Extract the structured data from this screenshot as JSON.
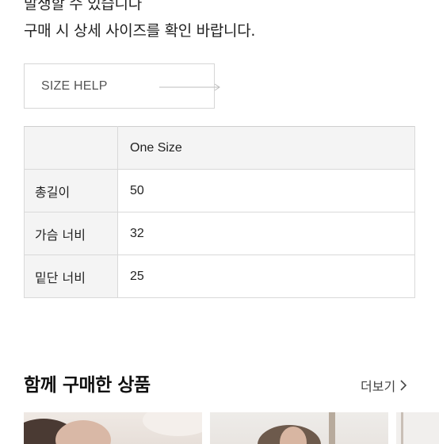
{
  "notice": {
    "line1": "발생할 수 있습니다",
    "line2": "구매 시 상세 사이즈를 확인 바랍니다."
  },
  "size_help": {
    "label": "SIZE HELP",
    "icon": "arrow-right-icon"
  },
  "size_table": {
    "header": [
      "",
      "One Size"
    ],
    "rows": [
      {
        "label": "총길이",
        "value": "50"
      },
      {
        "label": "가슴 너비",
        "value": "32"
      },
      {
        "label": "밑단 너비",
        "value": "25"
      }
    ]
  },
  "related": {
    "title": "함께 구매한 상품",
    "more_label": "더보기",
    "more_icon": "chevron-right-icon",
    "thumbnails": [
      "product-thumbnail-1",
      "product-thumbnail-2",
      "product-thumbnail-3"
    ]
  },
  "colors": {
    "border": "#d9d9d9",
    "header_bg": "#f4f4f4",
    "text": "#222222"
  }
}
